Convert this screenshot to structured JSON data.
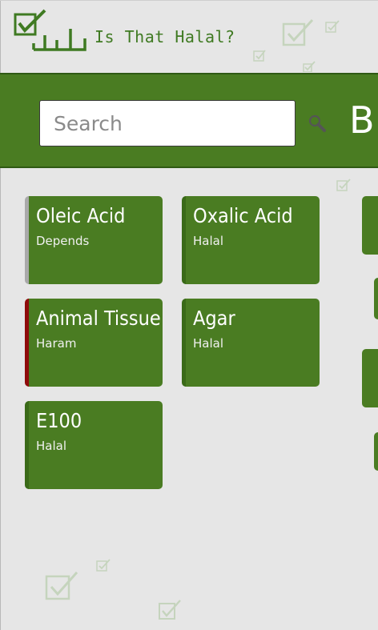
{
  "app": {
    "title": "Is That Halal?",
    "accent_color": "#4a7c22",
    "background_color": "#e6e6e6",
    "logo_icon": "halal-checkbox-logo"
  },
  "search": {
    "placeholder": "Search",
    "value": "",
    "icon": "search-icon"
  },
  "next_section": {
    "label_partial": "B"
  },
  "status_colors": {
    "Halal": "#3a6a18",
    "Depends": "#a9a9a9",
    "Haram": "#8f0b0b"
  },
  "items": [
    {
      "name": "Oleic Acid",
      "status": "Depends"
    },
    {
      "name": "Oxalic Acid",
      "status": "Halal"
    },
    {
      "name": "Animal Tissue",
      "status": "Haram"
    },
    {
      "name": "Agar",
      "status": "Halal"
    },
    {
      "name": "E100",
      "status": "Halal"
    }
  ]
}
